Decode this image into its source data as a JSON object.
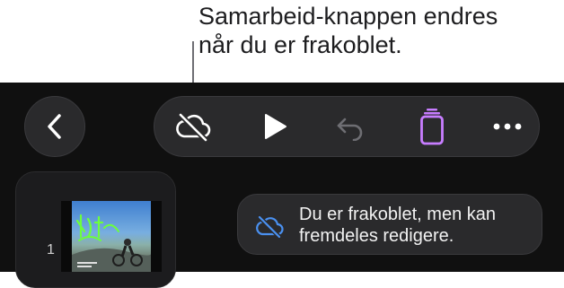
{
  "callout": {
    "line1": "Samarbeid-knappen endres",
    "line2": "når du er frakoblet."
  },
  "toolbar": {
    "back": "back-icon",
    "icons": [
      "cloud-offline-icon",
      "play-icon",
      "undo-icon",
      "slides-icon",
      "more-icon"
    ],
    "accent": "#c77dff"
  },
  "sidebar": {
    "slide_number": "1",
    "thumbnail_caption": "BIKE PARK"
  },
  "banner": {
    "text": "Du er frakoblet, men kan fremdeles redigere.",
    "icon": "cloud-offline-icon",
    "icon_color": "#4a90f0"
  }
}
